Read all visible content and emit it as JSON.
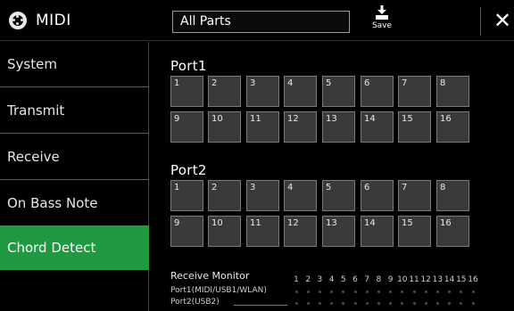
{
  "header": {
    "title": "MIDI",
    "parts_value": "All Parts",
    "save_label": "Save",
    "close_symbol": "✕",
    "icons": [
      "midi-icon",
      "save-icon",
      "close-icon"
    ]
  },
  "sidebar": {
    "items": [
      {
        "label": "System",
        "active": false
      },
      {
        "label": "Transmit",
        "active": false
      },
      {
        "label": "Receive",
        "active": false
      },
      {
        "label": "On Bass Note",
        "active": false
      },
      {
        "label": "Chord Detect",
        "active": true
      }
    ],
    "active_color": "#1f9a41"
  },
  "ports": [
    {
      "label": "Port1",
      "channels": [
        "1",
        "2",
        "3",
        "4",
        "5",
        "6",
        "7",
        "8",
        "9",
        "10",
        "11",
        "12",
        "13",
        "14",
        "15",
        "16"
      ]
    },
    {
      "label": "Port2",
      "channels": [
        "1",
        "2",
        "3",
        "4",
        "5",
        "6",
        "7",
        "8",
        "9",
        "10",
        "11",
        "12",
        "13",
        "14",
        "15",
        "16"
      ]
    }
  ],
  "monitor": {
    "title": "Receive Monitor",
    "channels": [
      "1",
      "2",
      "3",
      "4",
      "5",
      "6",
      "7",
      "8",
      "9",
      "10",
      "11",
      "12",
      "13",
      "14",
      "15",
      "16"
    ],
    "port_labels": [
      "Port1(MIDI/USB1/WLAN)",
      "Port2(USB2)"
    ]
  }
}
